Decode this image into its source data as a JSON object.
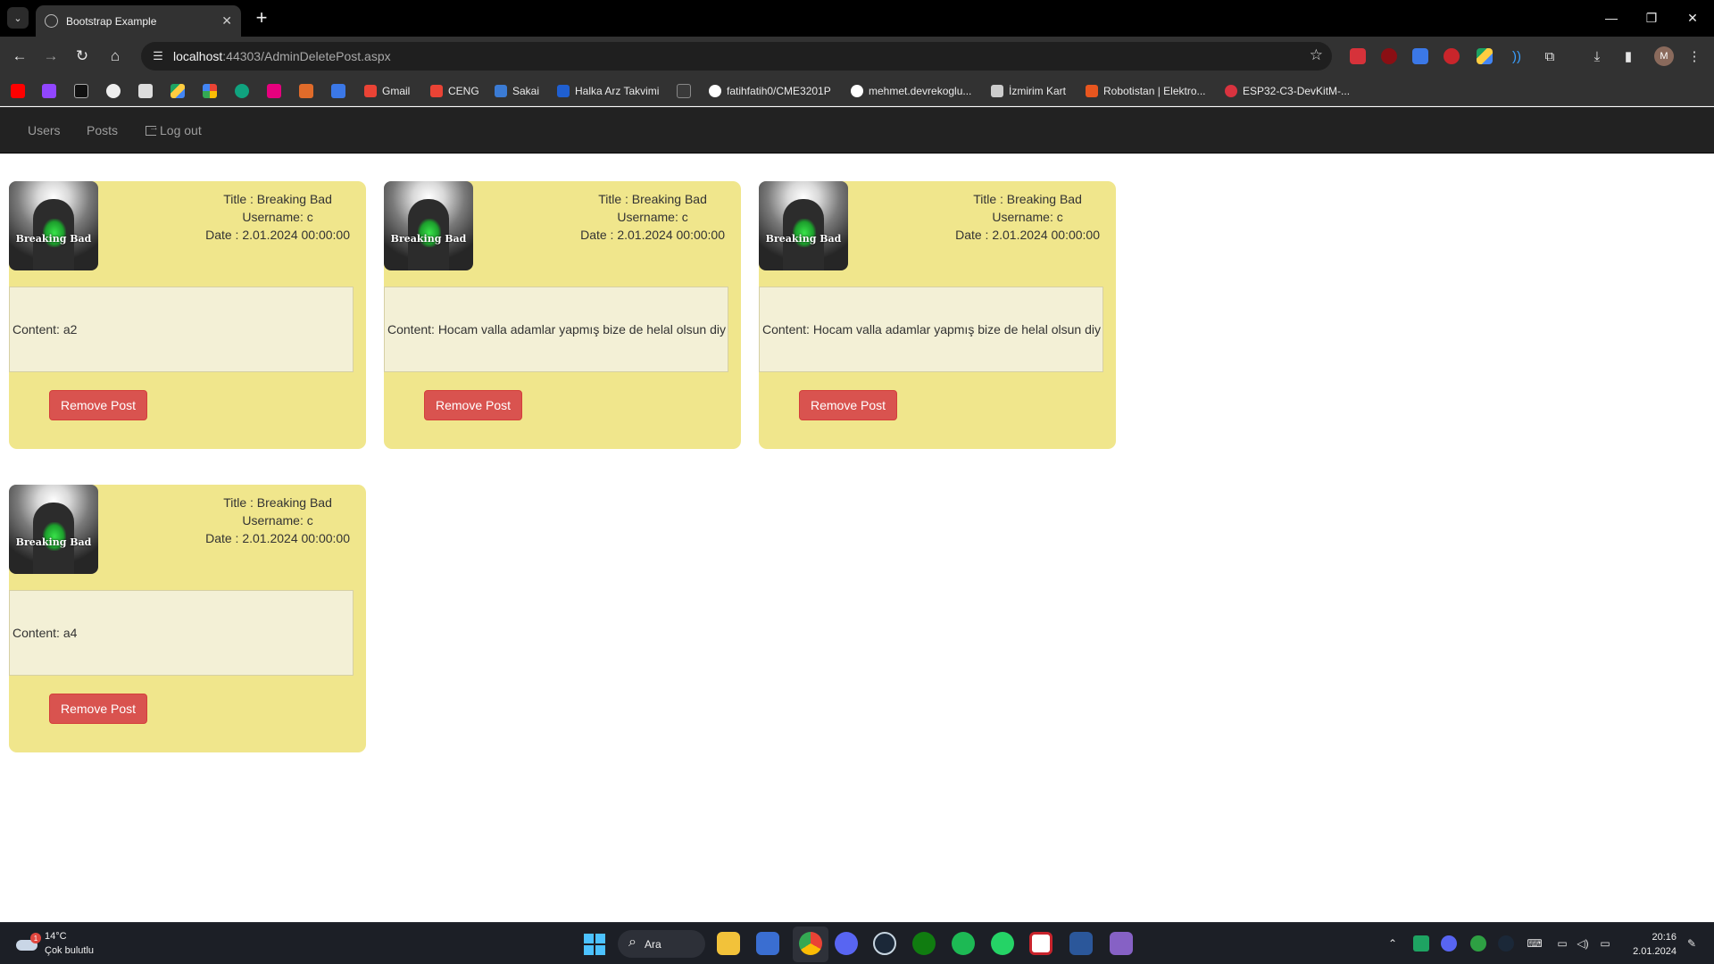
{
  "browser": {
    "tab_title": "Bootstrap Example",
    "new_tab": "+",
    "url_host": "localhost",
    "url_rest": ":44303/AdminDeletePost.aspx",
    "profile_initial": "M",
    "bookmarks": [
      {
        "label": "Gmail",
        "color": "#ea4335"
      },
      {
        "label": "CENG",
        "color": "#ea4335"
      },
      {
        "label": "Sakai",
        "color": "#3b7bd4"
      },
      {
        "label": "Halka Arz Takvimi",
        "color": "#1f5fd1"
      },
      {
        "label": "fatihfatih0/CME3201P",
        "color": "#ffffff"
      },
      {
        "label": "mehmet.devrekoglu...",
        "color": "#ffffff"
      },
      {
        "label": "İzmirim Kart",
        "color": "#cccccc"
      },
      {
        "label": "Robotistan | Elektro...",
        "color": "#e8561f"
      },
      {
        "label": "ESP32-C3-DevKitM-...",
        "color": "#d9333f"
      }
    ]
  },
  "navbar": {
    "items": [
      {
        "label": "Users"
      },
      {
        "label": "Posts"
      },
      {
        "label": "Log out"
      }
    ]
  },
  "posts": [
    {
      "image_text": "Breaking Bad",
      "title": "Title : Breaking Bad",
      "username": "Username: c",
      "date": "Date : 2.01.2024 00:00:00",
      "content": "Content: a2",
      "button": "Remove Post"
    },
    {
      "image_text": "Breaking Bad",
      "title": "Title : Breaking Bad",
      "username": "Username: c",
      "date": "Date : 2.01.2024 00:00:00",
      "content": "Content: Hocam valla adamlar yapmış bize de helal olsun diy",
      "button": "Remove Post"
    },
    {
      "image_text": "Breaking Bad",
      "title": "Title : Breaking Bad",
      "username": "Username: c",
      "date": "Date : 2.01.2024 00:00:00",
      "content": "Content: Hocam valla adamlar yapmış bize de helal olsun diy",
      "button": "Remove Post"
    },
    {
      "image_text": "Breaking Bad",
      "title": "Title : Breaking Bad",
      "username": "Username: c",
      "date": "Date : 2.01.2024 00:00:00",
      "content": "Content: a4",
      "button": "Remove Post"
    }
  ],
  "taskbar": {
    "weather_temp": "14°C",
    "weather_desc": "Çok bulutlu",
    "weather_badge": "1",
    "search_label": "Ara",
    "time": "20:16",
    "date": "2.01.2024"
  },
  "colors": {
    "card_bg": "#f0e68c",
    "content_bg": "#f3f0d6",
    "danger": "#d9533f",
    "navbar_bg": "#222222"
  }
}
